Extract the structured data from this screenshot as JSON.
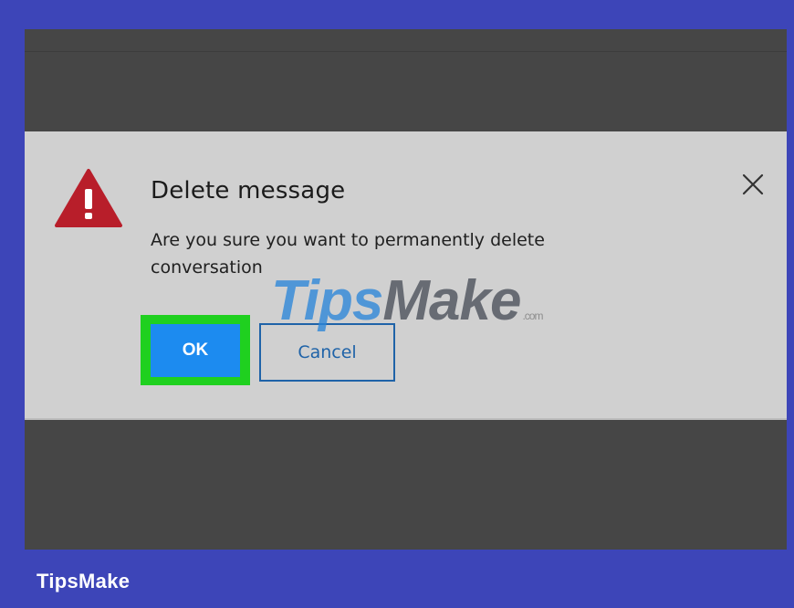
{
  "dialog": {
    "title": "Delete message",
    "message": "Are you sure you want to permanently delete conversation",
    "ok_label": "OK",
    "cancel_label": "Cancel",
    "warning_icon": "warning-triangle-icon",
    "close_icon": "close-icon"
  },
  "watermark": {
    "tips": "Tips",
    "make": "Make",
    "domain": ".com"
  },
  "footer": {
    "brand": "TipsMake"
  },
  "colors": {
    "frame": "#3d45b8",
    "screen_background": "#464646",
    "dialog_background": "#d0d0d0",
    "ok_button": "#1c8bf0",
    "highlight": "#1fd01f",
    "cancel_border": "#1f63a8",
    "warning": "#b81e2a"
  }
}
